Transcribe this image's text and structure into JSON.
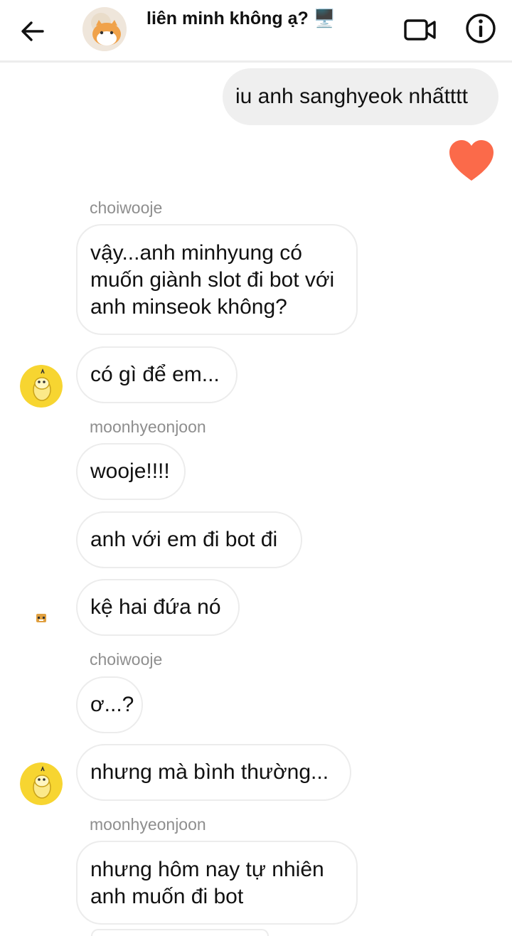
{
  "header": {
    "title": "liên minh không ạ? 🖥️",
    "back_icon": "arrow-left-icon",
    "video_icon": "video-call-icon",
    "info_icon": "info-icon"
  },
  "messages": {
    "m1": "iu anh sanghyeok nhấtttt",
    "sender1": "choiwooje",
    "m2": "vậy...anh minhyung có muốn giành slot đi bot với anh minseok không?",
    "m3": "có gì để em...",
    "sender2": "moonhyeonjoon",
    "m4": "wooje!!!!",
    "m5": "anh với em đi bot đi",
    "m6": "kệ hai đứa nó",
    "sender3": "choiwooje",
    "m7": "ơ...?",
    "m8": "nhưng mà bình thường...",
    "sender4": "moonhyeonjoon",
    "m9": "nhưng hôm nay tự nhiên anh muốn đi bot"
  },
  "colors": {
    "heart": "#fb6a4a",
    "avatar_yellow": "#f7d531",
    "sent_bubble": "#efefef"
  }
}
